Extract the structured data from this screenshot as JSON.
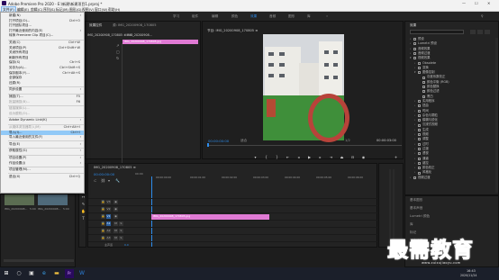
{
  "window": {
    "title": "Adobe Premiere Pro 2020 - E:\\新建\\新建项目1.prproj *",
    "minimize": "—",
    "maximize": "☐",
    "close": "✕"
  },
  "menubar": [
    "文件(F)",
    "编辑(E)",
    "剪辑(C)",
    "序列(S)",
    "标记(M)",
    "图形(G)",
    "视图(V)",
    "窗口(W)",
    "帮助(H)"
  ],
  "workspace_tabs": [
    "学习",
    "组件",
    "编辑",
    "颜色",
    "效果",
    "音频",
    "图形",
    "库"
  ],
  "active_workspace": "效果",
  "file_menu": [
    {
      "label": "新建(N)",
      "shortcut": "",
      "submenu": true
    },
    {
      "label": "打开项目(O)...",
      "shortcut": "Ctrl+O"
    },
    {
      "label": "打开团队项目...",
      "shortcut": ""
    },
    {
      "label": "打开最近使用的内容(E)",
      "shortcut": "",
      "submenu": true
    },
    {
      "label": "转换 Premiere Clip 项目(C)...",
      "shortcut": ""
    },
    {
      "sep": true
    },
    {
      "label": "关闭(C)",
      "shortcut": "Ctrl+W"
    },
    {
      "label": "关闭项目(P)",
      "shortcut": "Ctrl+Shift+W"
    },
    {
      "label": "关闭所有项目",
      "shortcut": ""
    },
    {
      "label": "刷新所有项目",
      "shortcut": ""
    },
    {
      "label": "保存(S)",
      "shortcut": "Ctrl+S"
    },
    {
      "label": "另存为(A)...",
      "shortcut": "Ctrl+Shift+S"
    },
    {
      "label": "保存副本(Y)...",
      "shortcut": "Ctrl+Alt+S"
    },
    {
      "label": "全部保存",
      "shortcut": ""
    },
    {
      "label": "还原(R)",
      "shortcut": ""
    },
    {
      "sep": true
    },
    {
      "label": "同步设置",
      "shortcut": "",
      "submenu": true
    },
    {
      "sep": true
    },
    {
      "label": "捕捉(T)...",
      "shortcut": "F5"
    },
    {
      "label": "批量捕捉(B)...",
      "shortcut": "F6",
      "disabled": true
    },
    {
      "sep": true
    },
    {
      "label": "链接媒体(L)...",
      "shortcut": "",
      "disabled": true
    },
    {
      "label": "设为脱机(O)...",
      "shortcut": "",
      "disabled": true
    },
    {
      "sep": true
    },
    {
      "label": "Adobe Dynamic Link(K)",
      "shortcut": "",
      "submenu": true
    },
    {
      "sep": true
    },
    {
      "label": "从媒体浏览器导入(M)",
      "shortcut": "Ctrl+Alt+I",
      "disabled": true
    },
    {
      "label": "导入(I)...",
      "shortcut": "Ctrl+I",
      "highlighted": true
    },
    {
      "label": "导入最近使用的文件(F)",
      "shortcut": "",
      "submenu": true
    },
    {
      "sep": true
    },
    {
      "label": "导出(E)",
      "shortcut": "",
      "submenu": true
    },
    {
      "sep": true
    },
    {
      "label": "获取属性(G)",
      "shortcut": "",
      "submenu": true
    },
    {
      "sep": true
    },
    {
      "label": "项目设置(P)",
      "shortcut": "",
      "submenu": true
    },
    {
      "label": "作品设置(J)",
      "shortcut": "",
      "submenu": true
    },
    {
      "sep": true
    },
    {
      "label": "项目管理(M)...",
      "shortcut": ""
    },
    {
      "sep": true
    },
    {
      "label": "退出(X)",
      "shortcut": "Ctrl+Q"
    }
  ],
  "effect_controls": {
    "tab": "效果控件",
    "sub": "源: IMG_20200908_170805",
    "clip_name": "IMG_20200908_170805.jpg",
    "header": "IMG_20200908_170805 × IMG_20200908...",
    "timecode_top": "00:00"
  },
  "program_monitor": {
    "tab": "节目: IMG_20200908_170805 ≡",
    "timecode_left": "00:00:00:00",
    "fit": "适合",
    "zoom": "1/2",
    "timecode_right": "00:00:03:00"
  },
  "effects_panel": {
    "tab": "效果",
    "items": [
      {
        "label": "预设",
        "indent": 0,
        "expanded": false
      },
      {
        "label": "Lumetri 预设",
        "indent": 0,
        "expanded": false
      },
      {
        "label": "音频效果",
        "indent": 0,
        "expanded": false
      },
      {
        "label": "音频过渡",
        "indent": 0,
        "expanded": false
      },
      {
        "label": "视频效果",
        "indent": 0,
        "expanded": true
      },
      {
        "label": "Obsolete",
        "indent": 1,
        "expanded": false
      },
      {
        "label": "变换",
        "indent": 1,
        "expanded": false
      },
      {
        "label": "图像控制",
        "indent": 1,
        "expanded": true
      },
      {
        "label": "灰度系数校正",
        "indent": 2,
        "leaf": true
      },
      {
        "label": "颜色平衡 (RGB)",
        "indent": 2,
        "leaf": true
      },
      {
        "label": "颜色替换",
        "indent": 2,
        "leaf": true
      },
      {
        "label": "颜色过滤",
        "indent": 2,
        "leaf": true
      },
      {
        "label": "黑白",
        "indent": 2,
        "leaf": true
      },
      {
        "label": "实用程序",
        "indent": 1,
        "expanded": false
      },
      {
        "label": "扭曲",
        "indent": 1,
        "expanded": false
      },
      {
        "label": "时间",
        "indent": 1,
        "expanded": false
      },
      {
        "label": "杂色与颗粒",
        "indent": 1,
        "expanded": false
      },
      {
        "label": "模糊与锐化",
        "indent": 1,
        "expanded": false
      },
      {
        "label": "沉浸式视频",
        "indent": 1,
        "expanded": false
      },
      {
        "label": "生成",
        "indent": 1,
        "expanded": false
      },
      {
        "label": "视频",
        "indent": 1,
        "expanded": false
      },
      {
        "label": "调整",
        "indent": 1,
        "expanded": false
      },
      {
        "label": "过时",
        "indent": 1,
        "expanded": false
      },
      {
        "label": "过渡",
        "indent": 1,
        "expanded": false
      },
      {
        "label": "透视",
        "indent": 1,
        "expanded": false
      },
      {
        "label": "通道",
        "indent": 1,
        "expanded": false
      },
      {
        "label": "键控",
        "indent": 1,
        "expanded": false
      },
      {
        "label": "颜色校正",
        "indent": 1,
        "expanded": false
      },
      {
        "label": "风格化",
        "indent": 1,
        "expanded": false
      },
      {
        "label": "视频过渡",
        "indent": 0,
        "expanded": false
      }
    ],
    "bottom_panels": [
      "基本图形",
      "基本声音",
      "Lumetri 颜色",
      "库",
      "标记",
      "历史记录",
      "信息"
    ]
  },
  "timeline": {
    "tab": "IMG_20200908_170805 ≡",
    "timecode": "00:00:00:00",
    "ruler": [
      "00:00",
      "00:00:00:00",
      "00:00:01:00",
      "00:00:02:00",
      "00:00:03:00",
      "00:00:04:00",
      "00:00:05:00",
      "00:00:06:00"
    ],
    "video_tracks": [
      "V3",
      "V2",
      "V1"
    ],
    "audio_tracks": [
      "A1",
      "A2",
      "A3"
    ],
    "master": "主声道",
    "master_value": "0.0",
    "clip_label": "IMG_20200908_170805.jpg"
  },
  "project_thumbs": [
    {
      "name": "IMG_20200908...",
      "dur": "5:00"
    },
    {
      "name": "IMG_20200908...",
      "dur": "5:00"
    }
  ],
  "taskbar": {
    "time": "16:43",
    "date": "2020/11/24"
  },
  "watermark": {
    "text": "最需教育",
    "url": "www.zuixujiaoyu.com"
  }
}
